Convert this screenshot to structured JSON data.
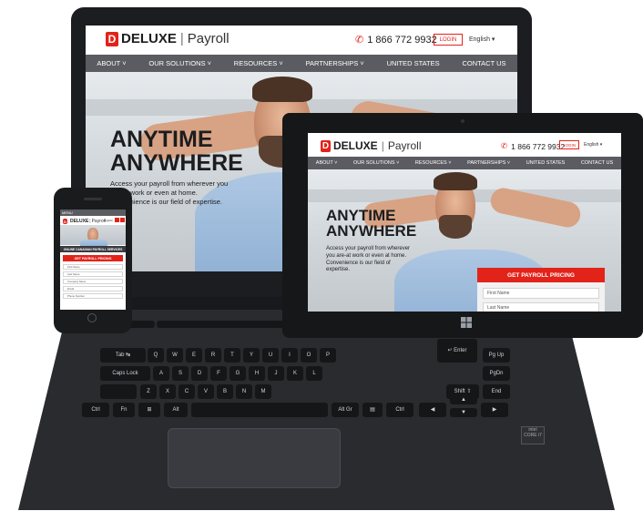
{
  "brand": {
    "name": "DELUXE",
    "product": "Payroll",
    "accent": "#e2231a",
    "nav_bg": "#5a5c61"
  },
  "header": {
    "phone": "1 866 772 9932",
    "login_label": "LOGIN",
    "language": "English"
  },
  "nav": {
    "items": [
      "ABOUT",
      "OUR SOLUTIONS",
      "RESOURCES",
      "PARTNERSHIPS",
      "UNITED STATES",
      "CONTACT US"
    ]
  },
  "hero": {
    "title_line1": "ANYTIME",
    "title_line2": "ANYWHERE",
    "text": "Access your payroll from wherever you are-at work or even at home. Convenience is our field of expertise.",
    "laptop_text": "Access your payroll from wherever you are-at work or even at home. Convenience is our field of expertise."
  },
  "form": {
    "cta": "GET PAYROLL PRICING",
    "fields": [
      "First Name",
      "Last Name",
      "Company Name",
      "Email",
      "Phone Number"
    ]
  },
  "mobile": {
    "menu": "MENU",
    "banner": "ONLINE CANADIAN PAYROLL SERVICES"
  },
  "keyboard": {
    "row1": [
      "Q",
      "W",
      "E",
      "R",
      "T",
      "Y",
      "U",
      "I",
      "O",
      "P"
    ],
    "row2": [
      "A",
      "S",
      "D",
      "F",
      "G",
      "H",
      "J",
      "K",
      "L"
    ],
    "row3": [
      "Z",
      "X",
      "C",
      "V",
      "B",
      "N",
      "M"
    ],
    "tab": "Tab ↹",
    "caps": "Caps Lock",
    "shift_right": "Shift ⇧",
    "enter": "↵ Enter",
    "backspace": "Backspace",
    "pgup": "Pg Up",
    "pgdn": "PgDn",
    "end": "End",
    "ctrl": "Ctrl",
    "fn": "Fn",
    "alt": "Alt",
    "altgr": "Alt Gr"
  },
  "device_badge": "intel CORE i7"
}
